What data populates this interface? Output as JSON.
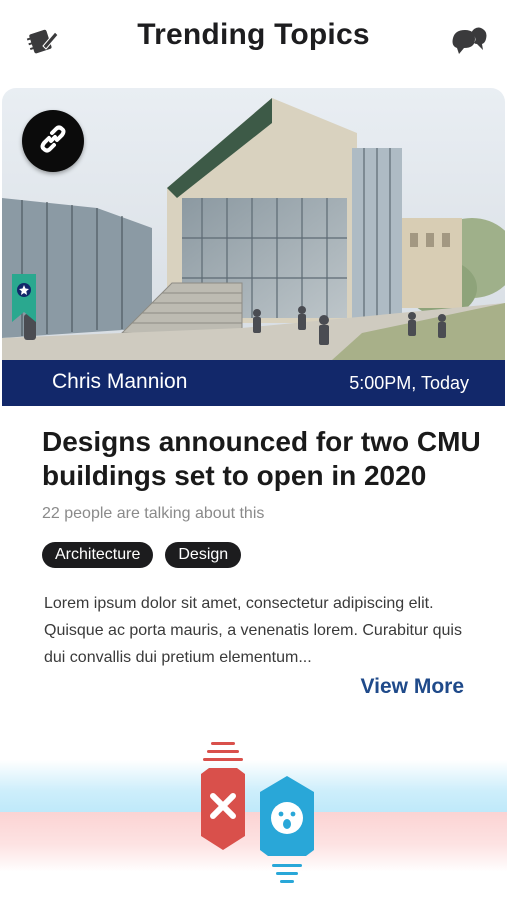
{
  "header": {
    "title": "Trending Topics",
    "left_icon": "edit-notebook-icon",
    "right_icon": "chat-bubbles-icon"
  },
  "article": {
    "image_alt": "Architectural rendering of a modern glass building",
    "link_icon": "link-icon",
    "ribbon_icon": "bookmark-ribbon-icon",
    "author": "Chris Mannion",
    "time": "5:00PM, Today",
    "headline": "Designs announced for two CMU buildings set to open in 2020",
    "discussion": "22 people are talking about this",
    "tags": [
      "Architecture",
      "Design"
    ],
    "body": "Lorem ipsum dolor sit amet, consectetur adipiscing elit. Quisque ac porta mauris, a venenatis lorem. Curabitur quis dui convallis dui pretium elementum...",
    "view_more": "View More"
  },
  "actions": {
    "dislike_icon": "close-x-icon",
    "like_icon": "surprised-face-icon"
  },
  "colors": {
    "author_bar": "#12286a",
    "ribbon": "#2aa88f",
    "view_more": "#1f4a8a",
    "dislike": "#d9504b",
    "like": "#29a7d8"
  }
}
